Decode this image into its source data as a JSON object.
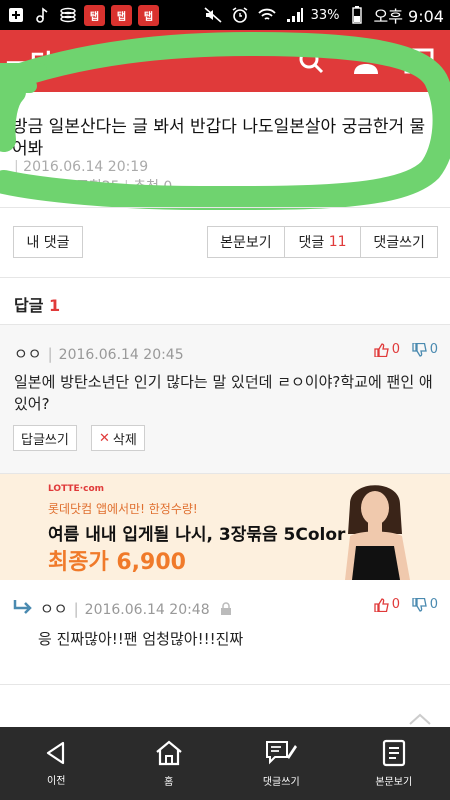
{
  "status_bar": {
    "app_badges": [
      "탭",
      "탭",
      "탭"
    ],
    "battery": "33%",
    "time": "오후 9:04"
  },
  "header": {
    "logo_fragment": "ㅡ단"
  },
  "post": {
    "title": "방금 일본산다는 글 봐서 반갑다 나도일본살아 궁금한거 물어봐",
    "date": "2016.06.14 20:19",
    "views": "조회25",
    "recommend": "추천 0"
  },
  "actions": {
    "my_comments": "내 댓글",
    "view_post": "본문보기",
    "comments_label": "댓글",
    "comments_count": "11",
    "write_comment": "댓글쓰기"
  },
  "replies_header": {
    "label": "답글",
    "count": "1"
  },
  "comment": {
    "user": "ㅇㅇ",
    "date": "2016.06.14 20:45",
    "text": "일본에 방탄소년단 인기 많다는 말 있던데 ㄹㅇ이야?학교에 팬인 애 있어?",
    "upvotes": "0",
    "downvotes": "0",
    "reply_button": "답글쓰기",
    "delete_button": "삭제"
  },
  "ad": {
    "brand": "LOTTE·com",
    "subtitle": "롯데닷컴 앱에서만! 한정수량!",
    "headline": "여름 내내 입게될 나시, 3장묶음 5Color",
    "price": "최종가 6,900"
  },
  "reply": {
    "user": "ㅇㅇ",
    "date": "2016.06.14 20:48",
    "text": "응 진짜많아!!팬 엄청많아!!!진짜",
    "upvotes": "0",
    "downvotes": "0"
  },
  "bottom_nav": {
    "items": [
      {
        "label": "이전",
        "icon": "back-icon"
      },
      {
        "label": "홈",
        "icon": "home-icon"
      },
      {
        "label": "댓글쓰기",
        "icon": "write-comment-icon"
      },
      {
        "label": "본문보기",
        "icon": "document-icon"
      }
    ]
  }
}
